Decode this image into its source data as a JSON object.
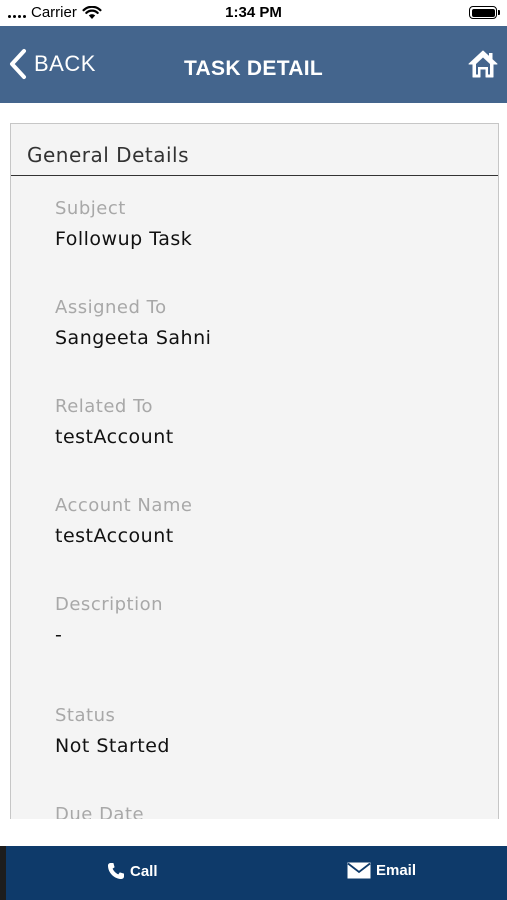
{
  "status_bar": {
    "carrier": "Carrier",
    "time": "1:34 PM"
  },
  "nav": {
    "back_label": "BACK",
    "title": "TASK DETAIL",
    "icons": {
      "back": "chevron-left-icon",
      "home": "home-icon"
    }
  },
  "card": {
    "header": "General Details",
    "fields": [
      {
        "label": "Subject",
        "value": "Followup Task"
      },
      {
        "label": "Assigned To",
        "value": "Sangeeta Sahni"
      },
      {
        "label": "Related To",
        "value": "testAccount"
      },
      {
        "label": "Account Name",
        "value": "testAccount"
      },
      {
        "label": "Description",
        "value": "-"
      },
      {
        "label": "Status",
        "value": "Not Started"
      },
      {
        "label": "Due Date",
        "value": ""
      }
    ]
  },
  "bottom_bar": {
    "call_label": "Call",
    "email_label": "Email",
    "icons": {
      "call": "phone-icon",
      "email": "envelope-icon"
    }
  },
  "colors": {
    "nav_bar": "#44658d",
    "bottom_bar": "#0e3a6a",
    "card_bg": "#f4f4f4",
    "label": "#a8a8a8"
  }
}
